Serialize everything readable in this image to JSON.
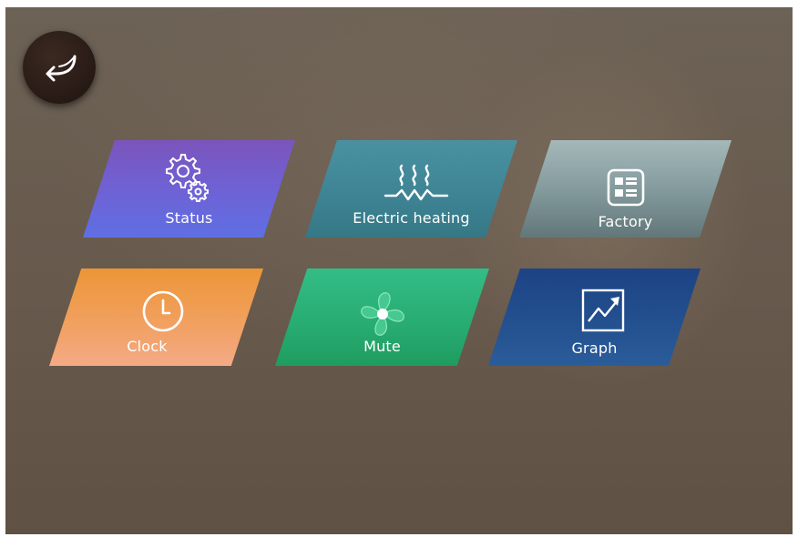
{
  "back": {
    "icon": "return-arrow-icon"
  },
  "tiles": {
    "status": {
      "label": "Status",
      "icon": "gears-icon"
    },
    "heating": {
      "label": "Electric heating",
      "icon": "heating-element-icon"
    },
    "factory": {
      "label": "Factory",
      "icon": "list-grid-icon"
    },
    "clock": {
      "label": "Clock",
      "icon": "clock-icon"
    },
    "mute": {
      "label": "Mute",
      "icon": "fan-icon"
    },
    "graph": {
      "label": "Graph",
      "icon": "trend-chart-icon"
    }
  },
  "colors": {
    "background": "#675a4d",
    "status": "#6d63d6",
    "heating": "#3e8495",
    "factory": "#849b9e",
    "clock": "#f1a05f",
    "mute": "#28ad73",
    "graph": "#23508f"
  }
}
